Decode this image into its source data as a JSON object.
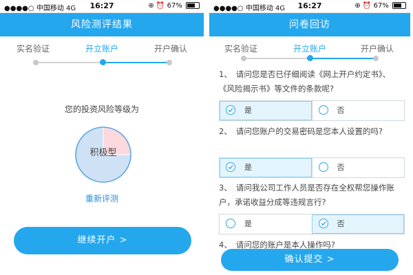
{
  "status_bar": {
    "signal": "●●●●○",
    "carrier": "中国移动",
    "network": "4G",
    "time": "16:27",
    "status_icons": "⊕ ⏰",
    "battery": "67%"
  },
  "left_screen": {
    "title": "风险测评结果",
    "steps": [
      {
        "label": "实名验证",
        "active": false
      },
      {
        "label": "开立账户",
        "active": true
      },
      {
        "label": "开户确认",
        "active": false
      }
    ],
    "risk_prompt": "您的投资风险等级为",
    "risk_level": "积极型",
    "chart_data": {
      "type": "pie",
      "values": [
        25,
        75
      ],
      "colors": [
        "#fcd9dd",
        "#cfe1f5"
      ],
      "tick_label": "积极型"
    },
    "retake_link": "重新评测",
    "continue_button": "继续开户 >"
  },
  "right_screen": {
    "title": "问卷回访",
    "steps": [
      {
        "label": "实名验证",
        "active": false
      },
      {
        "label": "开立账户",
        "active": true
      },
      {
        "label": "开户确认",
        "active": false
      }
    ],
    "questions": [
      {
        "number": "1、",
        "text": "请问您是否已仔细阅读《网上开户约定书》、《风险揭示书》等文件的条款呢?",
        "options": [
          {
            "label": "是",
            "selected": true
          },
          {
            "label": "否",
            "selected": false
          }
        ]
      },
      {
        "number": "2、",
        "text": "请问您账户的交易密码是您本人设置的吗?",
        "options": [
          {
            "label": "是",
            "selected": true
          },
          {
            "label": "否",
            "selected": false
          }
        ]
      },
      {
        "number": "3、",
        "text": "请问我公司工作人员是否存在全权帮您操作账户，承诺收益分成等违规言行?",
        "options": [
          {
            "label": "是",
            "selected": false
          },
          {
            "label": "否",
            "selected": true
          }
        ]
      },
      {
        "number": "4、",
        "text": "请问您的账户是本人操作吗?"
      }
    ],
    "confirm_button": "确认提交 >"
  },
  "colors": {
    "primary": "#25a7ee",
    "selected_bg": "#e3f4fc",
    "pie_red": "#fcd9dd",
    "pie_blue": "#cfe1f5"
  }
}
